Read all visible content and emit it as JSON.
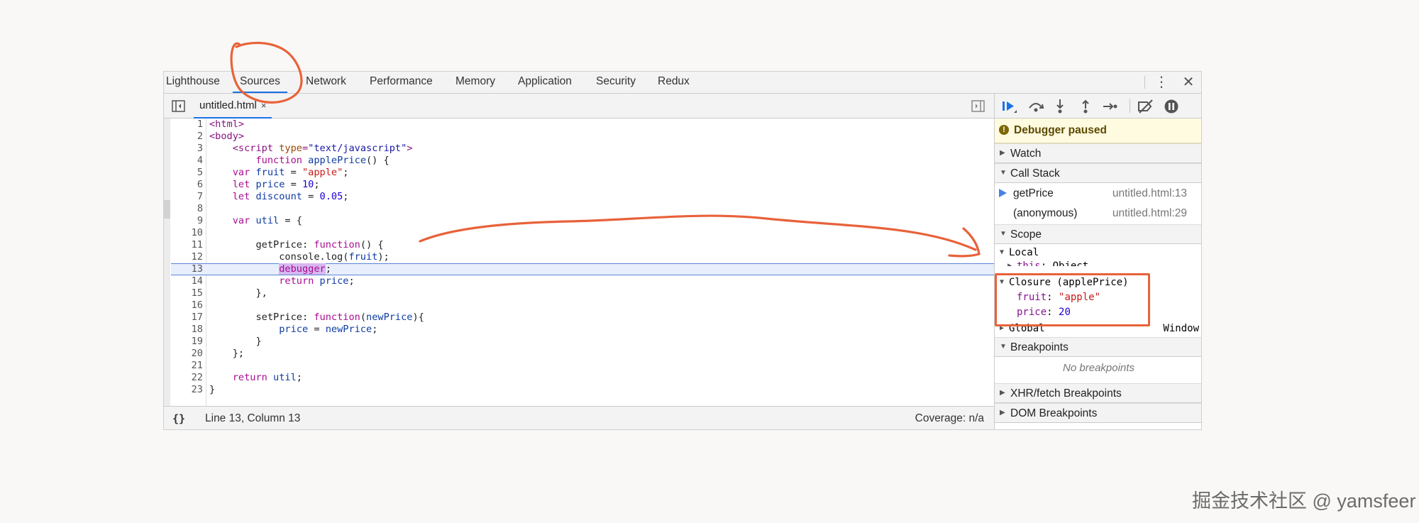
{
  "top_tabs": {
    "lighthouse": "Lighthouse",
    "sources": "Sources",
    "network": "Network",
    "performance": "Performance",
    "memory": "Memory",
    "application": "Application",
    "security": "Security",
    "redux": "Redux"
  },
  "top_icons": {
    "menu": "kebab-icon",
    "close": "close-icon"
  },
  "editor": {
    "file_tab": "untitled.html",
    "file_close": "×",
    "current_line": 13,
    "line_numbers": [
      "1",
      "2",
      "3",
      "4",
      "5",
      "6",
      "7",
      "8",
      "9",
      "10",
      "11",
      "12",
      "13",
      "14",
      "15",
      "16",
      "17",
      "18",
      "19",
      "20",
      "21",
      "22",
      "23"
    ]
  },
  "code_tokens": {
    "l1_html": "<html>",
    "l2_body": "<body>",
    "l3_open": "<script",
    "l3_attr": "type",
    "l3_eq": "=",
    "l3_val": "\"text/javascript\"",
    "l3_close": ">",
    "kw_function": "function",
    "l4_name": "applePrice",
    "l4_rest": "() {",
    "kw_var": "var",
    "l5_id": "fruit",
    "op_eq": " = ",
    "l5_str": "\"apple\"",
    "semi": ";",
    "kw_let": "let",
    "l6_id": "price",
    "l6_num": "10",
    "l7_id": "discount",
    "l7_num": "0.05",
    "l9_id": "util",
    "l9_rest": " = {",
    "l11_prop": "getPrice",
    "colon": ": ",
    "l11_rest": "() {",
    "l12_text": "console.log(",
    "l12_arg": "fruit",
    "l12_end": ");",
    "l13_kw": "debugger",
    "kw_return": "return",
    "l14_id": "price",
    "l15_text": "},",
    "l17_prop": "setPrice",
    "l17_param": "newPrice",
    "l17_end": "){",
    "l18_lhs": "price",
    "l18_rhs": "newPrice",
    "l19_text": "}",
    "l20_text": "};",
    "l22_id": "util",
    "l23_text": "}"
  },
  "status_bar": {
    "icon": "{}",
    "position": "Line 13, Column 13",
    "coverage": "Coverage: n/a"
  },
  "debugger": {
    "paused_label": "Debugger paused",
    "watch_label": "Watch",
    "call_stack_label": "Call Stack",
    "call_stack": [
      {
        "fn": "getPrice",
        "loc": "untitled.html:13"
      },
      {
        "fn": "(anonymous)",
        "loc": "untitled.html:29"
      }
    ],
    "scope_label": "Scope",
    "local_label": "Local",
    "local_this_key": "this",
    "local_this_val": "Object",
    "closure_label": "Closure (applePrice)",
    "closure_fruit_key": "fruit",
    "closure_fruit_val": "\"apple\"",
    "closure_price_key": "price",
    "closure_price_val": "20",
    "global_label": "Global",
    "global_val": "Window",
    "breakpoints_label": "Breakpoints",
    "no_breakpoints": "No breakpoints",
    "xhr_label": "XHR/fetch Breakpoints",
    "dom_label": "DOM Breakpoints"
  },
  "watermark": "掘金技术社区 @ yamsfeer",
  "colors": {
    "annotation": "#e8623a",
    "accent": "#1a73e8"
  }
}
